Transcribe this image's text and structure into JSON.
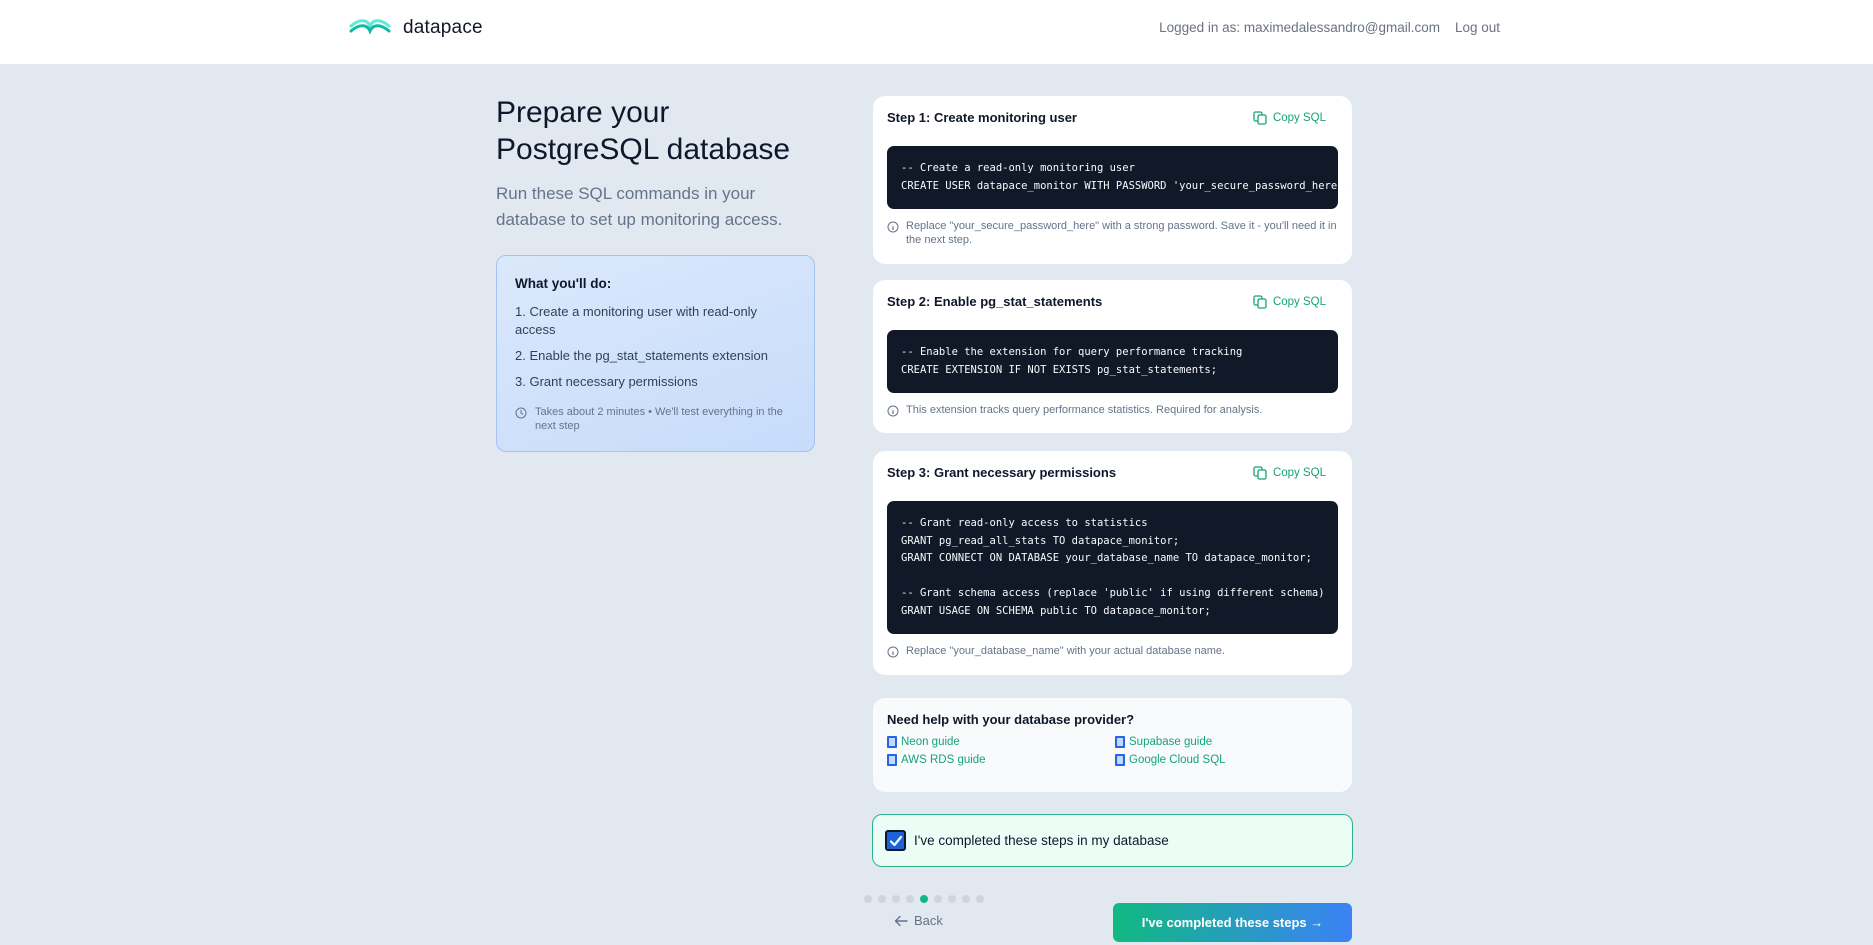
{
  "app": {
    "brand_name": "datapace",
    "logged_in_text": "Logged in as: maximedalessandro@gmail.com",
    "logout_label": "Log out"
  },
  "intro": {
    "title": "Prepare your PostgreSQL database",
    "subtitle": "Run these SQL commands in your database to set up monitoring access."
  },
  "todo": {
    "heading": "What you'll do:",
    "items": [
      "1. Create a monitoring user with read-only access",
      "2. Enable the pg_stat_statements extension",
      "3. Grant necessary permissions"
    ],
    "note": "Takes about 2 minutes • We'll test everything in the next step"
  },
  "steps": [
    {
      "title": "Step 1: Create monitoring user",
      "copy_label": "Copy SQL",
      "code": "-- Create a read-only monitoring user\nCREATE USER datapace_monitor WITH PASSWORD 'your_secure_password_here';",
      "hint": "Replace \"your_secure_password_here\" with a strong password. Save it - you'll need it in the next step."
    },
    {
      "title": "Step 2: Enable pg_stat_statements",
      "copy_label": "Copy SQL",
      "code": "-- Enable the extension for query performance tracking\nCREATE EXTENSION IF NOT EXISTS pg_stat_statements;",
      "hint": "This extension tracks query performance statistics. Required for analysis."
    },
    {
      "title": "Step 3: Grant necessary permissions",
      "copy_label": "Copy SQL",
      "code": "-- Grant read-only access to statistics\nGRANT pg_read_all_stats TO datapace_monitor;\nGRANT CONNECT ON DATABASE your_database_name TO datapace_monitor;\n\n-- Grant schema access (replace 'public' if using different schema)\nGRANT USAGE ON SCHEMA public TO datapace_monitor;",
      "hint": "Replace \"your_database_name\" with your actual database name."
    }
  ],
  "help": {
    "heading": "Need help with your database provider?",
    "links": [
      "Neon guide",
      "Supabase guide",
      "AWS RDS guide",
      "Google Cloud SQL"
    ]
  },
  "confirm": {
    "label": "I've completed these steps in my database",
    "checked": true
  },
  "progress": {
    "total_steps": 9,
    "current_step": 5
  },
  "nav": {
    "back_label": "Back",
    "next_label": "I've completed these steps →"
  },
  "colors": {
    "accent_green": "#10b981",
    "link_green": "#16a37a",
    "code_bg": "#111827",
    "page_bg": "#e2e8f0"
  }
}
